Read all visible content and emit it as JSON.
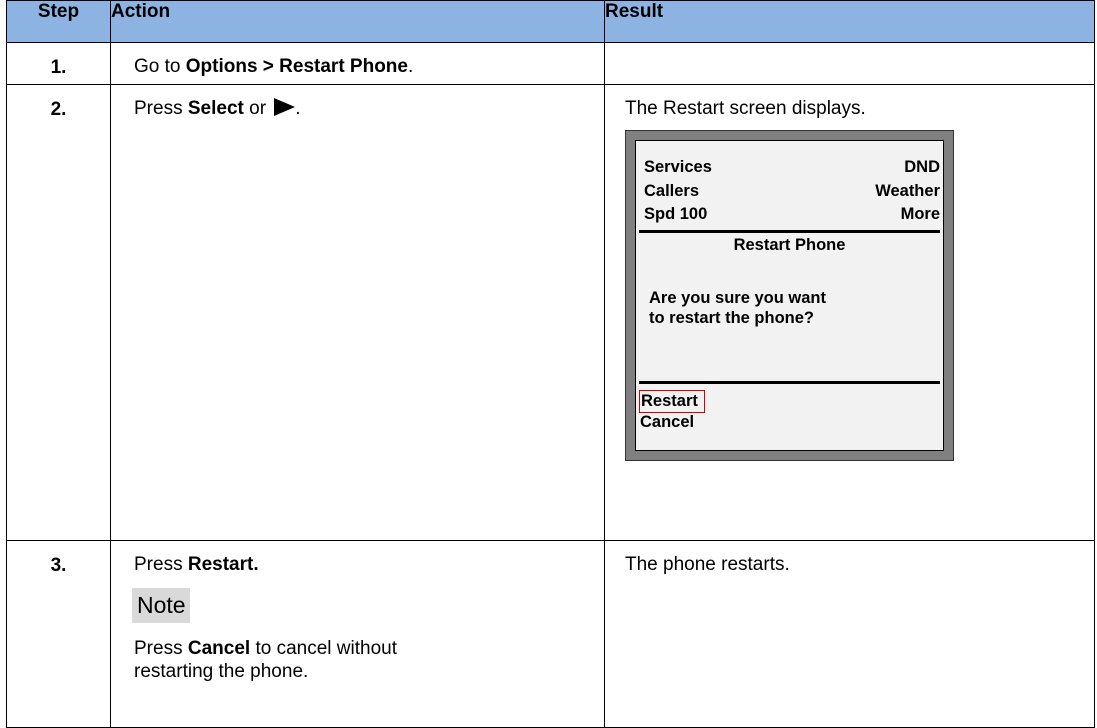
{
  "table": {
    "headers": {
      "step": "Step",
      "action": "Action",
      "result": "Result"
    },
    "rows": [
      {
        "step": "1.",
        "action_pre": "Go to ",
        "action_bold": "Options > Restart Phone",
        "action_post": ".",
        "result": ""
      },
      {
        "step": "2.",
        "action_pre": "Press ",
        "action_bold": "Select",
        "action_mid": " or ",
        "action_icon": "right-arrow-icon",
        "action_post": ".",
        "result": "The Restart screen displays."
      },
      {
        "step": "3.",
        "action_pre": "Press ",
        "action_bold": "Restart.",
        "note_label": "Note",
        "note_bold": "Cancel",
        "note_pre": "Press ",
        "note_post_line1": " to cancel without",
        "note_line2": "restarting the phone.",
        "result": "The phone restarts."
      }
    ]
  },
  "phone_screen": {
    "menu": [
      {
        "left": "Services",
        "right": "DND"
      },
      {
        "left": "Callers",
        "right": "Weather"
      },
      {
        "left": "Spd 100",
        "right": "More"
      }
    ],
    "title": "Restart Phone",
    "message_line1": "Are you sure you want",
    "message_line2": "to restart the phone?",
    "softkeys": [
      "Restart",
      "Cancel"
    ],
    "highlight_color": "#d40000"
  },
  "colors": {
    "header_bg": "#8db3e2",
    "screen_bg": "#f2f2f2",
    "bezel": "#808080"
  }
}
